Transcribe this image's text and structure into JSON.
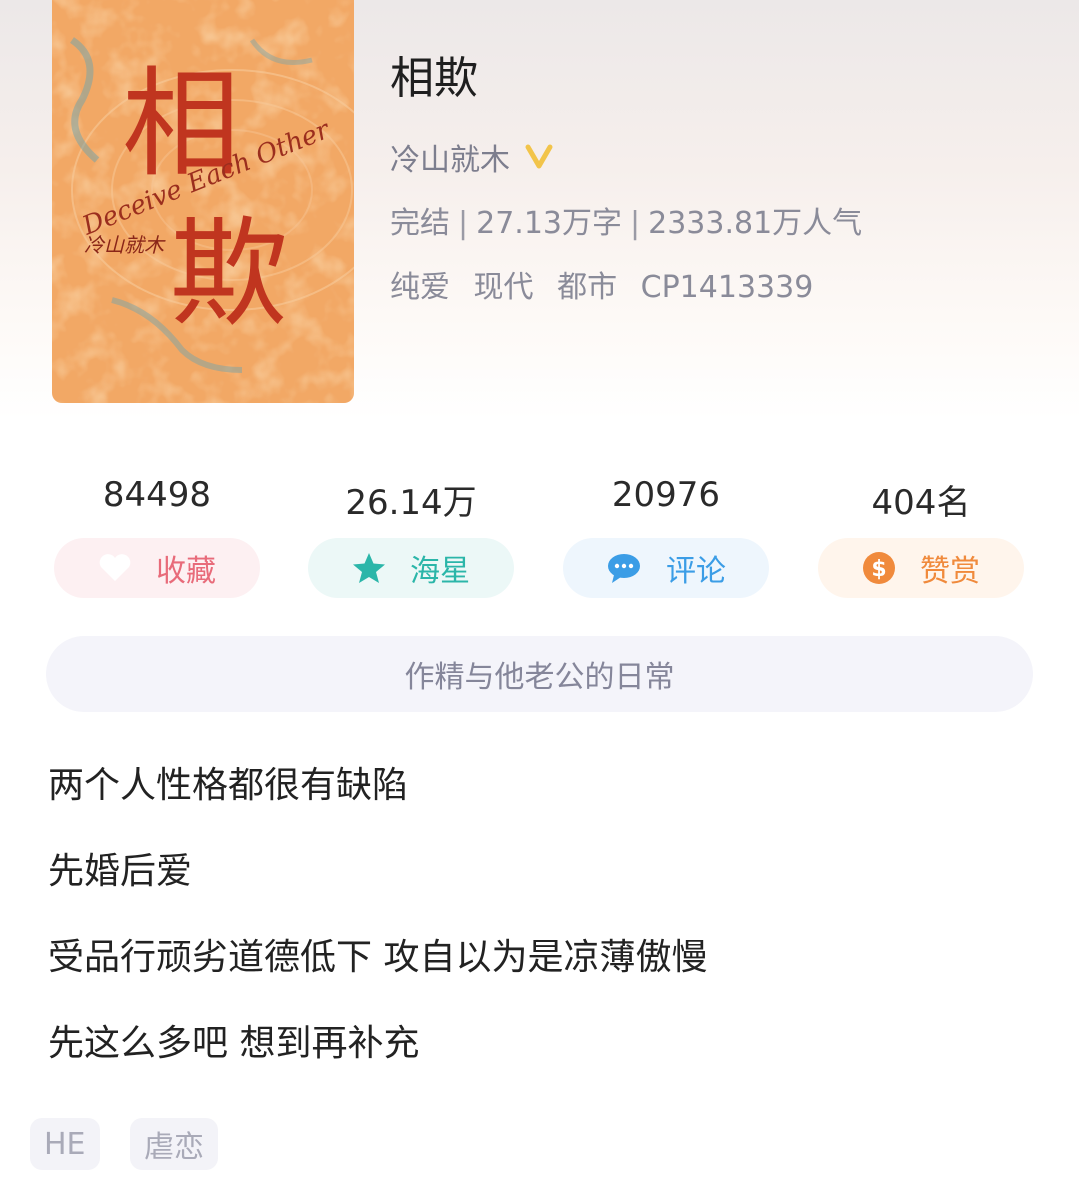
{
  "book": {
    "title": "相欺",
    "author": "冷山就木",
    "status": "完结",
    "word_count": "27.13万字",
    "popularity": "2333.81万人气",
    "tags": [
      "纯爱",
      "现代",
      "都市",
      "CP1413339"
    ]
  },
  "cover": {
    "title_chars": [
      "相",
      "欺"
    ],
    "english_title": "Deceive Each Other",
    "signature": "冷山就木"
  },
  "metrics": [
    {
      "value": "84498",
      "label": "收藏",
      "icon": "heart-icon",
      "color": "#e86b7a",
      "bg": "#fdf0f2"
    },
    {
      "value": "26.14万",
      "label": "海星",
      "icon": "star-icon",
      "color": "#2bb6a9",
      "bg": "#ecf8f7"
    },
    {
      "value": "20976",
      "label": "评论",
      "icon": "comment-icon",
      "color": "#3b9de6",
      "bg": "#eef6fd"
    },
    {
      "value": "404名",
      "label": "赞赏",
      "icon": "coin-icon",
      "color": "#f08a3c",
      "bg": "#fff5ec"
    }
  ],
  "intro_tagline": "作精与他老公的日常",
  "description_lines": [
    "两个人性格都很有缺陷",
    "先婚后爱",
    "受品行顽劣道德低下 攻自以为是凉薄傲慢",
    "先这么多吧 想到再补充"
  ],
  "chips": [
    "HE",
    "虐恋"
  ]
}
